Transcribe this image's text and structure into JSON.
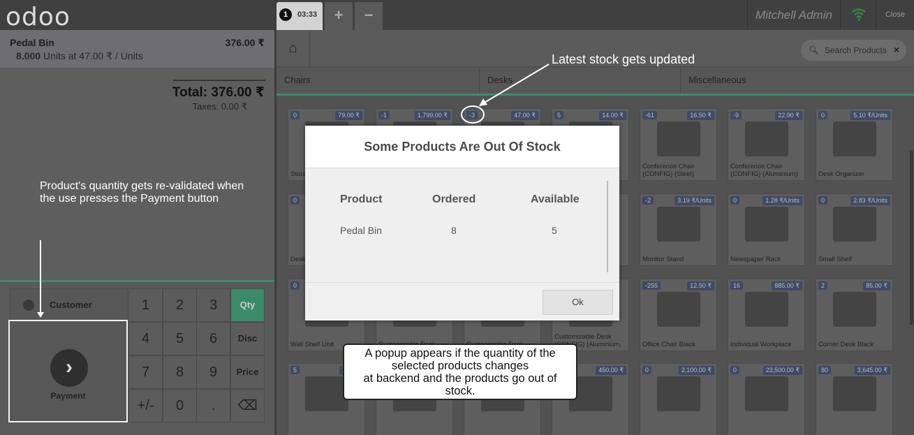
{
  "app": {
    "logo": "odoo",
    "user": "Mitchell Admin",
    "close": "Close"
  },
  "order_tabs": [
    {
      "number": "1",
      "time": "03:33"
    }
  ],
  "tab_buttons": {
    "add": "+",
    "remove": "−"
  },
  "order": {
    "line": {
      "product": "Pedal Bin",
      "price": "376.00 ₹",
      "qty": "8.000",
      "info": " Units at 47.00 ₹ / Units"
    },
    "total": "Total: 376.00 ₹",
    "taxes": "Taxes: 0.00 ₹"
  },
  "pad": {
    "customer": "Customer",
    "payment": "Payment",
    "keys": [
      "1",
      "2",
      "3",
      "Qty",
      "4",
      "5",
      "6",
      "Disc",
      "7",
      "8",
      "9",
      "Price",
      "+/-",
      "0",
      ".",
      "⌫"
    ]
  },
  "search": {
    "placeholder": "Search Products"
  },
  "categories": [
    "Chairs",
    "Desks",
    "Miscellaneous"
  ],
  "products": [
    {
      "stock": "0",
      "price": "79.00 ₹",
      "name": "Stora..."
    },
    {
      "stock": "-1",
      "price": "1,799.00 ₹",
      "name": ""
    },
    {
      "stock": "-3",
      "price": "47.00 ₹",
      "name": ""
    },
    {
      "stock": "5",
      "price": "14.00 ₹",
      "name": ""
    },
    {
      "stock": "-61",
      "price": "16.50 ₹",
      "name": "Conference Chair (CONFIG) (Steel)"
    },
    {
      "stock": "-9",
      "price": "22.90 ₹",
      "name": "Conference Chair (CONFIG) (Aluminium)"
    },
    {
      "stock": "0",
      "price": "5.10 ₹/Units",
      "name": "Desk Organizer"
    },
    {
      "stock": "0",
      "price": "",
      "name": "Desk..."
    },
    {
      "stock": "",
      "price": "",
      "name": ""
    },
    {
      "stock": "",
      "price": "",
      "name": ""
    },
    {
      "stock": "",
      "price": "",
      "name": ""
    },
    {
      "stock": "-2",
      "price": "3.19 ₹/Units",
      "name": "Monitor Stand"
    },
    {
      "stock": "0",
      "price": "1.28 ₹/Units",
      "name": "Newspaper Rack"
    },
    {
      "stock": "0",
      "price": "2.83 ₹/Units",
      "name": "Small Shelf"
    },
    {
      "stock": "0",
      "price": "",
      "name": "Wall Shelf Unit"
    },
    {
      "stock": "",
      "price": "",
      "name": "Customizable Desk"
    },
    {
      "stock": "",
      "price": "",
      "name": "Customizable Desk"
    },
    {
      "stock": "",
      "price": "",
      "name": "Customizable Desk (CONFIG) (Aluminium,"
    },
    {
      "stock": "-255",
      "price": "12.50 ₹",
      "name": "Office Chair Black"
    },
    {
      "stock": "16",
      "price": "885.00 ₹",
      "name": "Individual Workplace"
    },
    {
      "stock": "2",
      "price": "85.00 ₹",
      "name": "Corner Desk Black"
    },
    {
      "stock": "5",
      "price": "2.95...",
      "name": ""
    },
    {
      "stock": "",
      "price": "",
      "name": ""
    },
    {
      "stock": "",
      "price": "",
      "name": ""
    },
    {
      "stock": "",
      "price": "450.00 ₹",
      "name": ""
    },
    {
      "stock": "0",
      "price": "2,100.00 ₹",
      "name": ""
    },
    {
      "stock": "0",
      "price": "23,500.00 ₹",
      "name": ""
    },
    {
      "stock": "80",
      "price": "3,645.00 ₹",
      "name": ""
    }
  ],
  "popup": {
    "title": "Some Products Are Out Of Stock",
    "headers": [
      "Product",
      "Ordered",
      "Available"
    ],
    "row": [
      "Pedal Bin",
      "8",
      "5"
    ],
    "ok": "Ok"
  },
  "annotations": {
    "top": "Latest stock gets updated",
    "left_1": "Product's quantity gets re-validated when",
    "left_2": " the use presses the Payment button",
    "callout_1": "A popup appears if the quantity of the",
    "callout_2": "selected products changes",
    "callout_3": "at backend and the products go out of",
    "callout_4": "stock."
  }
}
